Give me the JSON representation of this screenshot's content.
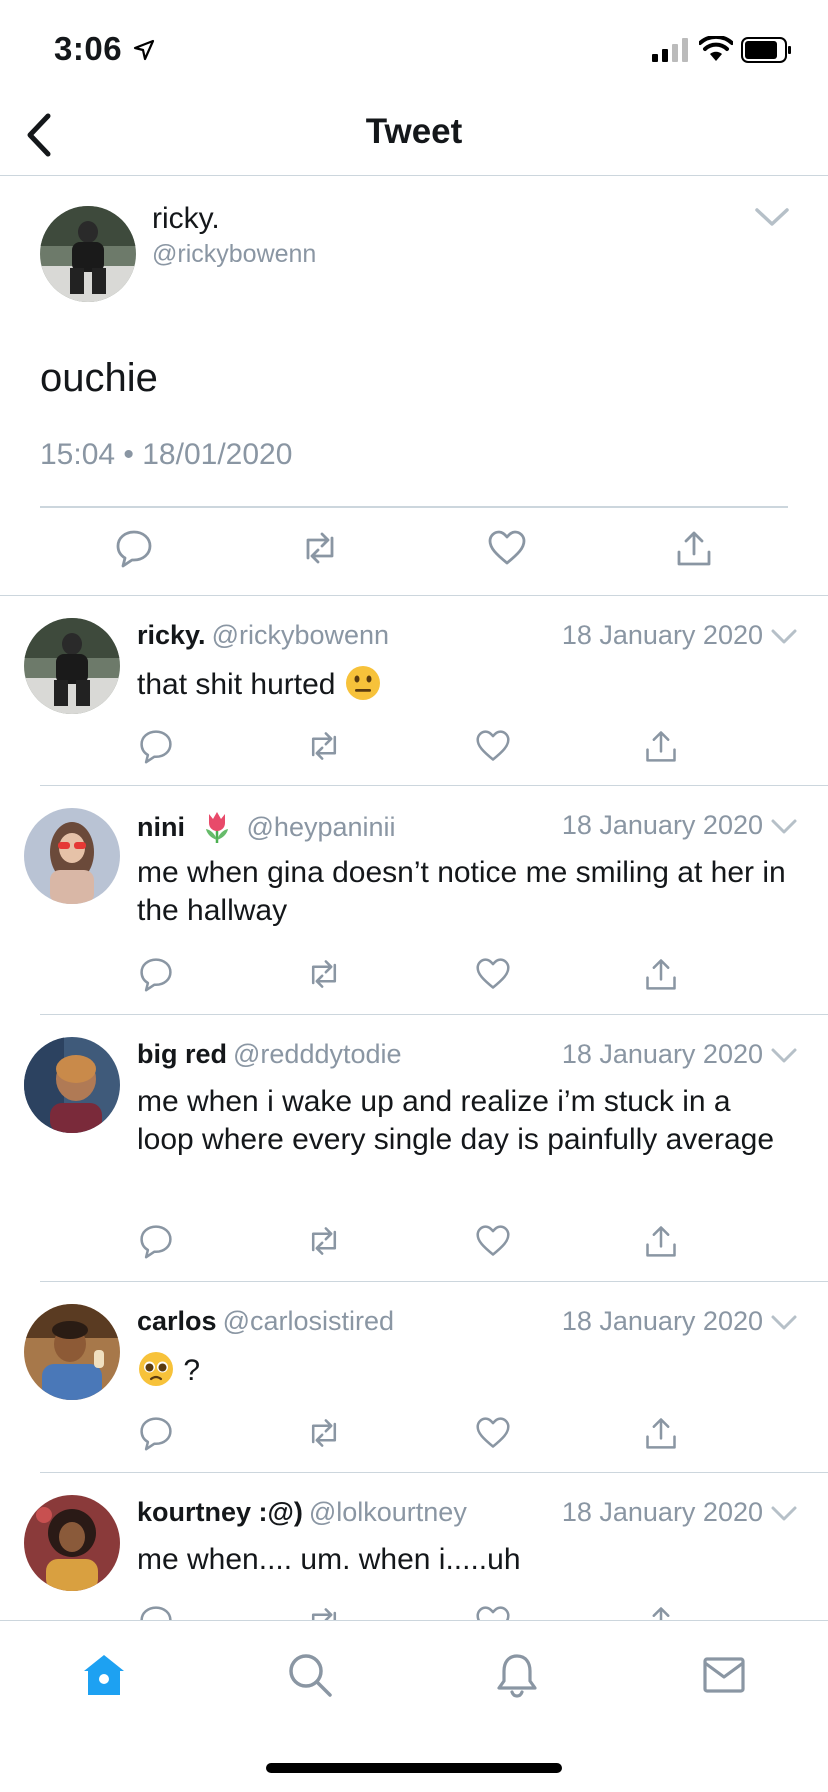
{
  "status_bar": {
    "time": "3:06"
  },
  "nav": {
    "title": "Tweet"
  },
  "main_tweet": {
    "name": "ricky.",
    "handle": "@rickybowenn",
    "text": "ouchie",
    "timestamp": "15:04 • 18/01/2020"
  },
  "replies": [
    {
      "name": "ricky.",
      "handle": "@rickybowenn",
      "date": "18 January 2020",
      "text": "that shit hurted",
      "emoji": "neutral-face"
    },
    {
      "name": "nini",
      "name_emoji": "tulip",
      "handle": "@heypaninii",
      "date": "18 January 2020",
      "text": "me when gina doesn’t notice me smiling at her in the hallway"
    },
    {
      "name": "big red",
      "handle": "@redddytodie",
      "date": "18 January 2020",
      "text": "me when i wake up and realize i’m stuck in a loop where every single day is painfully average"
    },
    {
      "name": "carlos",
      "handle": "@carlosistired",
      "date": "18 January 2020",
      "text": "?",
      "emoji": "pleading-face"
    },
    {
      "name": "kourtney :@)",
      "handle": "@lolkourtney",
      "date": "18 January 2020",
      "text": "me when.... um. when i.....uh"
    }
  ],
  "tab_bar": {
    "tabs": [
      {
        "icon": "home-icon",
        "active": true
      },
      {
        "icon": "search-icon",
        "active": false
      },
      {
        "icon": "notifications-icon",
        "active": false
      },
      {
        "icon": "messages-icon",
        "active": false
      }
    ]
  },
  "colors": {
    "accent": "#1da1f2",
    "text": "#14171a",
    "secondary": "#8a96a3",
    "divider": "#ccd6dd",
    "icon": "#8a96a3"
  }
}
